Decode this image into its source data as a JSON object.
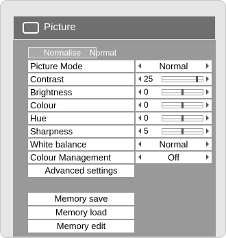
{
  "window": {
    "title": "Picture",
    "icon": "screen-icon"
  },
  "mode": {
    "button_label": "Normalise",
    "value": "Normal"
  },
  "rows": [
    {
      "label": "Picture Mode",
      "type": "select",
      "value": "Normal"
    },
    {
      "label": "Contrast",
      "type": "slider",
      "value": "25",
      "level": 0.86
    },
    {
      "label": "Brightness",
      "type": "slider",
      "value": "0",
      "level": 0.5
    },
    {
      "label": "Colour",
      "type": "slider",
      "value": "0",
      "level": 0.5
    },
    {
      "label": "Hue",
      "type": "slider",
      "value": "0",
      "level": 0.5
    },
    {
      "label": "Sharpness",
      "type": "slider",
      "value": "5",
      "level": 0.5
    },
    {
      "label": "White balance",
      "type": "select",
      "value": "Normal"
    },
    {
      "label": "Colour Management",
      "type": "select",
      "value": "Off"
    }
  ],
  "advanced": {
    "label": "Advanced settings"
  },
  "memory": {
    "save": "Memory save",
    "load": "Memory load",
    "edit": "Memory edit"
  },
  "colors": {
    "panel": "#999999",
    "title_bar": "#6f6f6f",
    "cell": "#ffffff"
  }
}
